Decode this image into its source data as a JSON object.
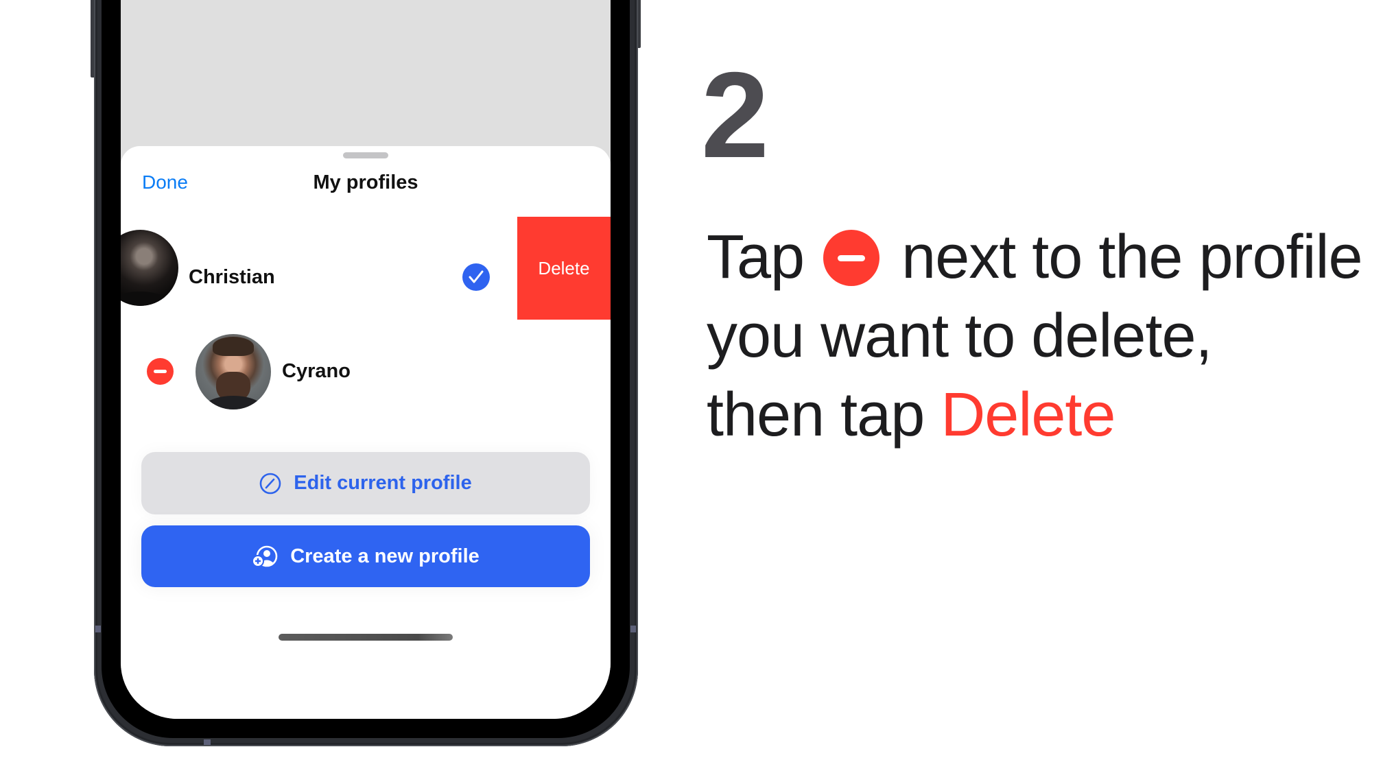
{
  "sheet": {
    "done_label": "Done",
    "title": "My profiles"
  },
  "profiles": [
    {
      "name": "Christian",
      "selected": true,
      "swipe_action": "Delete"
    },
    {
      "name": "Cyrano",
      "selected": false,
      "edit_control": "remove-icon"
    }
  ],
  "buttons": {
    "edit_label": "Edit current profile",
    "edit_icon": "pencil-circle-icon",
    "create_label": "Create a new profile",
    "create_icon": "person-add-icon"
  },
  "instructions": {
    "step_number": "2",
    "line1_before": "Tap",
    "line1_icon": "remove-circle-icon",
    "line1_after": "next to the profile",
    "line2": "you want to delete,",
    "line3_before": "then tap",
    "line3_highlight": "Delete"
  },
  "colors": {
    "accent_blue": "#2f64f2",
    "link_blue": "#0a7cf5",
    "destructive_red": "#ff3b30",
    "text_dark": "#1d1d1f",
    "step_gray": "#4d4c51"
  }
}
